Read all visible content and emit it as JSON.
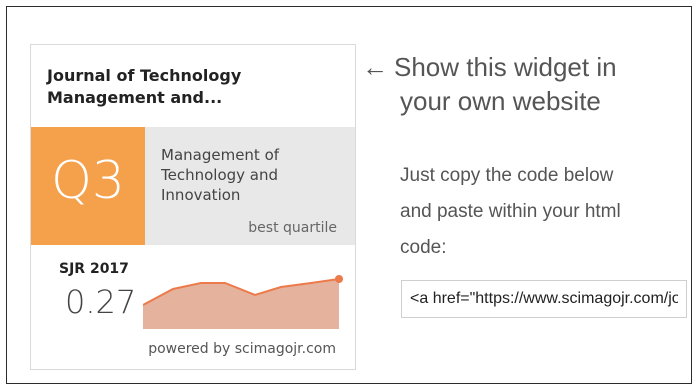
{
  "widget": {
    "journal_title_line1": "Journal of Technology",
    "journal_title_line2": "Management and...",
    "quartile": "Q3",
    "category_line1": "Management of",
    "category_line2": "Technology and",
    "category_line3": "Innovation",
    "best_quartile_label": "best quartile",
    "sjr_label": "SJR 2017",
    "sjr_value": "0.27",
    "powered_by": "powered by scimagojr.com",
    "colors": {
      "quartile_bg": "#f5a04b",
      "band_bg": "#e8e8e8",
      "chart_fill": "#e5b39d",
      "chart_line": "#ec7a4a"
    }
  },
  "side": {
    "arrow": "←",
    "show_line1": "Show this widget in",
    "show_line2": "your own website",
    "instr_line1": "Just copy the code below",
    "instr_line2": "and paste within your html",
    "instr_line3": "code:",
    "code_value": "<a href=\"https://www.scimagojr.com/journalsearch.php"
  }
}
